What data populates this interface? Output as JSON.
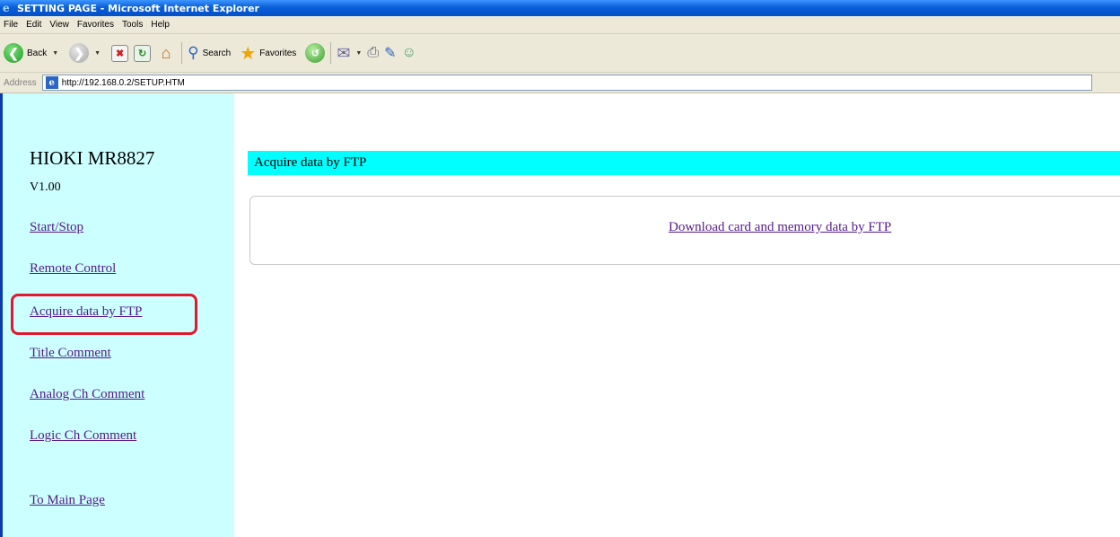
{
  "window": {
    "title": "SETTING PAGE - Microsoft Internet Explorer"
  },
  "menu": [
    "File",
    "Edit",
    "View",
    "Favorites",
    "Tools",
    "Help"
  ],
  "toolbar": {
    "back_label": "Back",
    "search_label": "Search",
    "favorites_label": "Favorites"
  },
  "address": {
    "label": "Address",
    "url": "http://192.168.0.2/SETUP.HTM"
  },
  "sidebar": {
    "brand": "HIOKI MR8827",
    "version": "V1.00",
    "items": [
      {
        "label": "Start/Stop"
      },
      {
        "label": "Remote Control"
      },
      {
        "label": "Acquire data by FTP"
      },
      {
        "label": "Title Comment"
      },
      {
        "label": "Analog Ch Comment"
      },
      {
        "label": "Logic Ch Comment"
      },
      {
        "label": "To Main Page"
      }
    ],
    "highlighted_item": "Acquire data by FTP"
  },
  "main": {
    "header": "Acquire data by FTP",
    "download_link": "Download card and memory data by FTP"
  },
  "colors": {
    "sidebar_bg": "#ccffff",
    "header_bg": "#00ffff",
    "link": "#551a8b",
    "highlight": "#e0192e"
  }
}
